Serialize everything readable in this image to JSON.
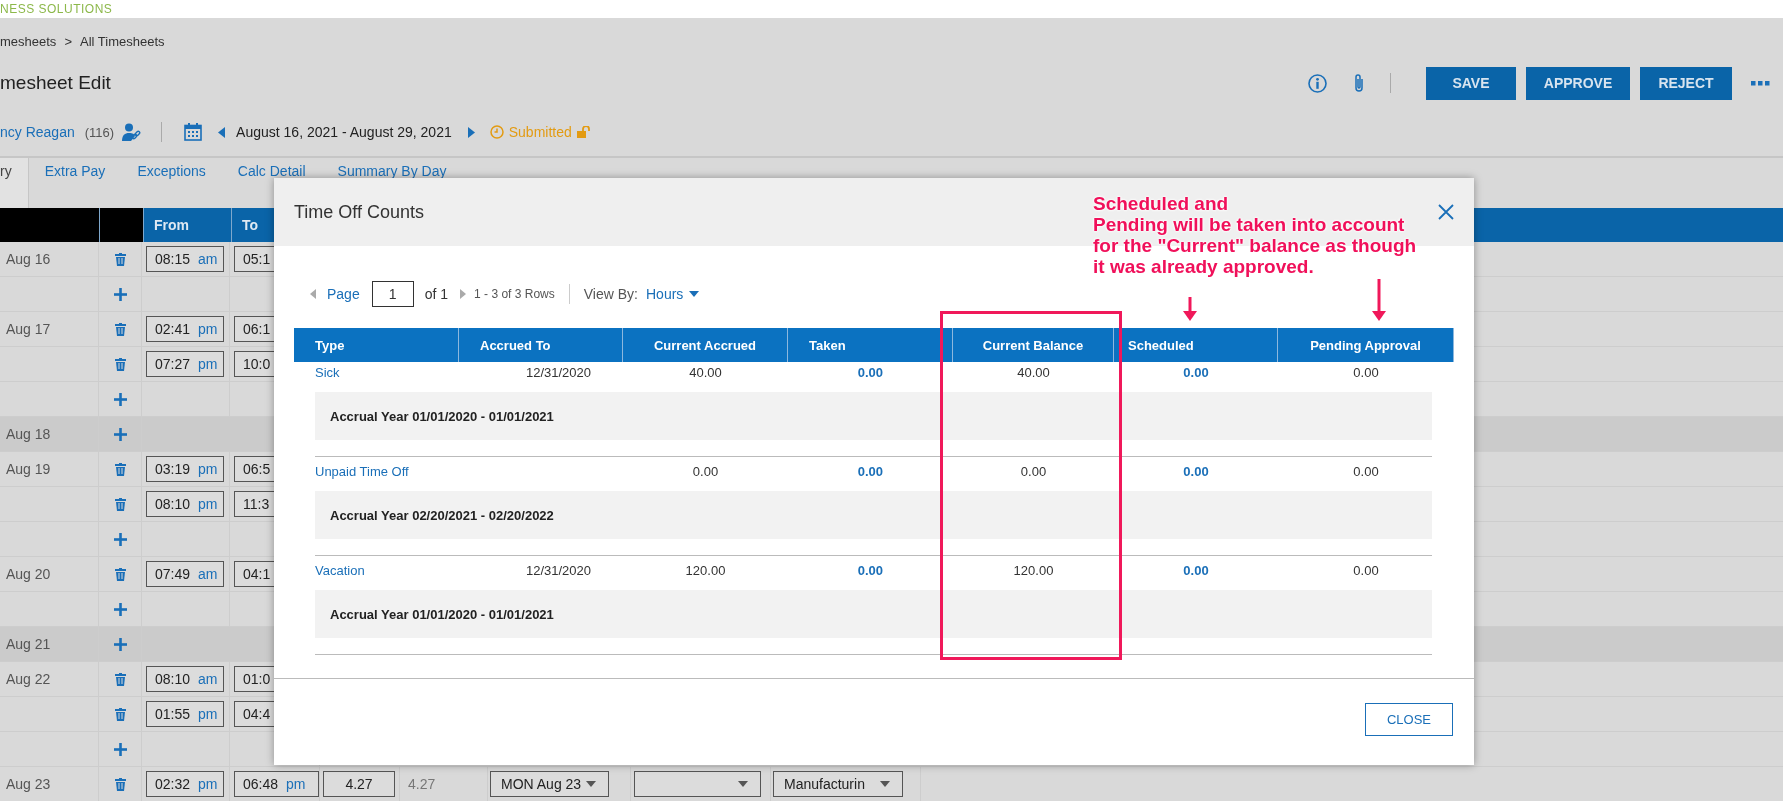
{
  "logo_text": "NESS SOLUTIONS",
  "breadcrumb": {
    "items": [
      "mesheets",
      "All Timesheets"
    ],
    "separator": ">"
  },
  "page_title": "mesheet Edit",
  "actions": [
    "SAVE",
    "APPROVE",
    "REJECT"
  ],
  "employee": {
    "name": "ncy Reagan",
    "number": "(116)"
  },
  "period": "August 16, 2021 - August 29, 2021",
  "status": "Submitted",
  "tabs": [
    {
      "label": "ry",
      "selected": true
    },
    {
      "label": "Extra Pay",
      "selected": false
    },
    {
      "label": "Exceptions",
      "selected": false
    },
    {
      "label": "Calc Detail",
      "selected": false
    },
    {
      "label": "Summary By Day",
      "selected": false
    }
  ],
  "grid": {
    "columns": [
      "From",
      "To"
    ],
    "rows": [
      {
        "kind": "entry",
        "day": "Aug 16",
        "from": "08:15",
        "from_ampm": "am",
        "to": "05:1"
      },
      {
        "kind": "add"
      },
      {
        "kind": "entry",
        "day": "Aug 17",
        "from": "02:41",
        "from_ampm": "pm",
        "to": "06:1"
      },
      {
        "kind": "entry",
        "from": "07:27",
        "from_ampm": "pm",
        "to": "10:0"
      },
      {
        "kind": "add"
      },
      {
        "kind": "day_off",
        "day": "Aug 18"
      },
      {
        "kind": "entry",
        "day": "Aug 19",
        "from": "03:19",
        "from_ampm": "pm",
        "to": "06:5"
      },
      {
        "kind": "entry",
        "from": "08:10",
        "from_ampm": "pm",
        "to": "11:3"
      },
      {
        "kind": "add"
      },
      {
        "kind": "entry",
        "day": "Aug 20",
        "from": "07:49",
        "from_ampm": "am",
        "to": "04:1"
      },
      {
        "kind": "add"
      },
      {
        "kind": "day_off",
        "day": "Aug 21"
      },
      {
        "kind": "entry",
        "day": "Aug 22",
        "from": "08:10",
        "from_ampm": "am",
        "to": "01:0"
      },
      {
        "kind": "entry",
        "from": "01:55",
        "from_ampm": "pm",
        "to": "04:4"
      },
      {
        "kind": "add"
      },
      {
        "kind": "full_entry",
        "day": "Aug 23",
        "from": "02:32",
        "from_ampm": "pm",
        "to": "06:48",
        "to_ampm": "pm",
        "hours": "4.27",
        "total": "4.27",
        "day_select": "MON Aug 23",
        "department": "Manufacturin"
      }
    ]
  },
  "modal": {
    "title": "Time Off Counts",
    "pager": {
      "page_label": "Page",
      "page": "1",
      "of": "of 1",
      "rows": "1 - 3 of 3 Rows",
      "view_by_label": "View By:",
      "view_by": "Hours"
    },
    "columns": [
      "Type",
      "Accrued To",
      "Current Accrued",
      "Taken",
      "Current Balance",
      "Scheduled",
      "Pending Approval"
    ],
    "rows": [
      {
        "type": "Sick",
        "accrued_to": "12/31/2020",
        "current_accrued": "40.00",
        "taken": "0.00",
        "current_balance": "40.00",
        "scheduled": "0.00",
        "pending_approval": "0.00",
        "accrual_year": "Accrual Year 01/01/2020 - 01/01/2021"
      },
      {
        "type": "Unpaid Time Off",
        "current_accrued": "0.00",
        "taken": "0.00",
        "current_balance": "0.00",
        "scheduled": "0.00",
        "pending_approval": "0.00",
        "accrual_year": "Accrual Year 02/20/2021 - 02/20/2022"
      },
      {
        "type": "Vacation",
        "accrued_to": "12/31/2020",
        "current_accrued": "120.00",
        "taken": "0.00",
        "current_balance": "120.00",
        "scheduled": "0.00",
        "pending_approval": "0.00",
        "accrual_year": "Accrual Year 01/01/2020 - 01/01/2021"
      }
    ],
    "close": "CLOSE"
  },
  "annotation": {
    "text": "Scheduled and\nPending will be taken into account\nfor the \"Current\" balance as though\nit was already approved."
  }
}
